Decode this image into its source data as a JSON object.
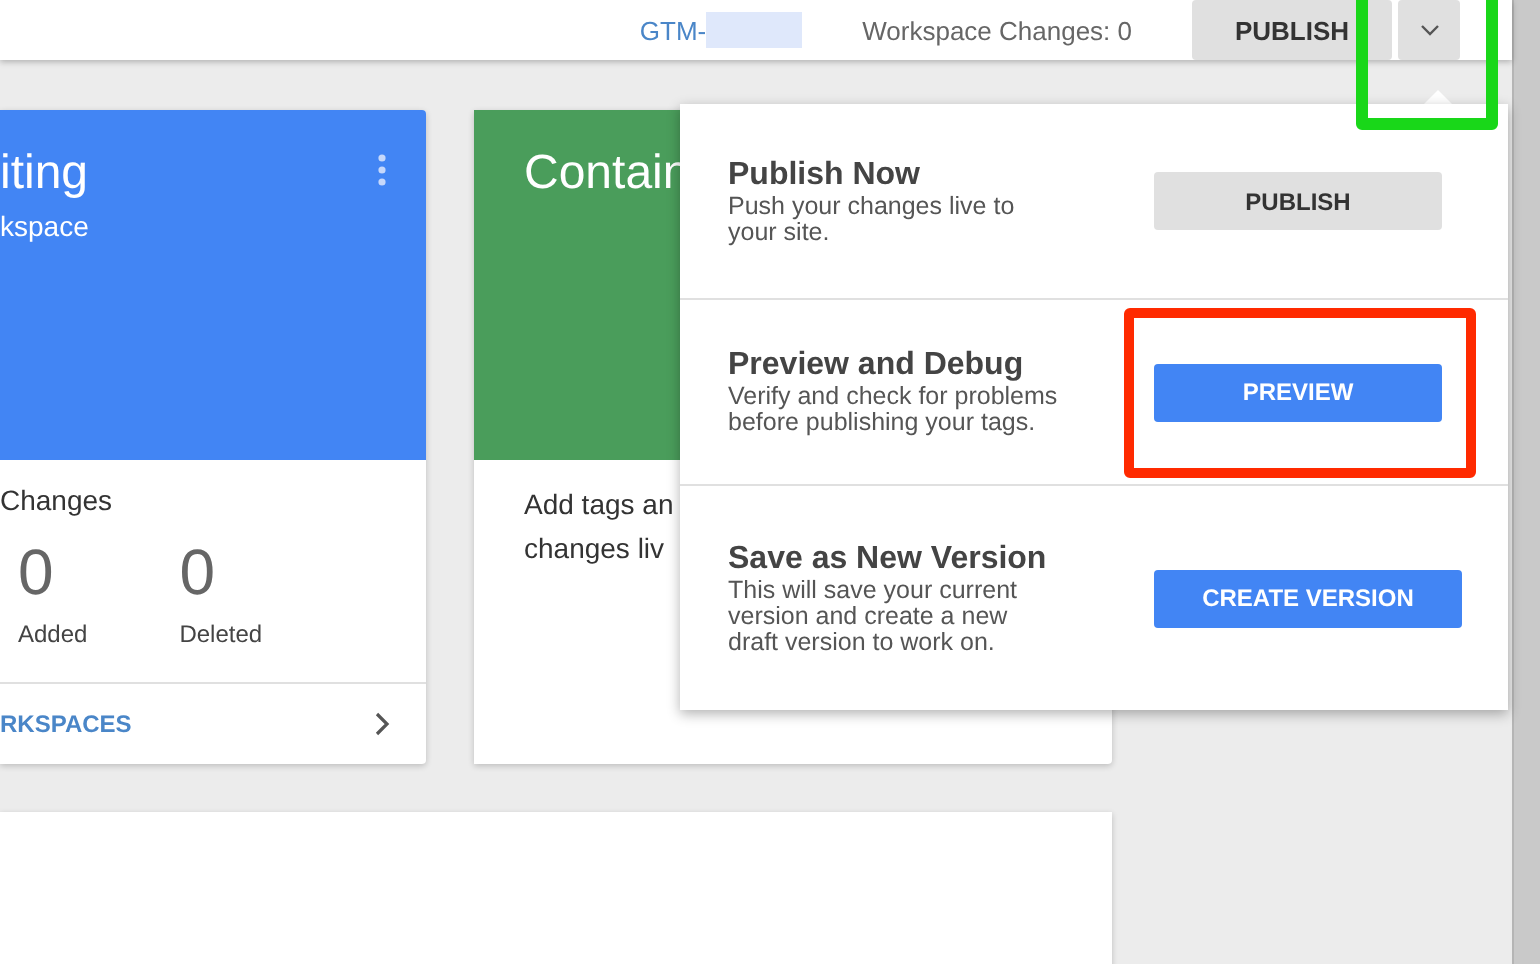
{
  "header": {
    "container_id": "GTM-",
    "workspace_changes": "Workspace Changes: 0",
    "publish_button": "PUBLISH",
    "menu_expanded": true
  },
  "workspace_card": {
    "title": "iting",
    "subtitle": "kspace",
    "changes_heading": "Changes",
    "stats": [
      {
        "value": "0",
        "label": "Added"
      },
      {
        "value": "0",
        "label": "Deleted"
      }
    ],
    "link": "RKSPACES"
  },
  "container_card": {
    "title": "Contain",
    "body_lines": [
      "Add tags an",
      "changes liv"
    ]
  },
  "publish_menu": {
    "options": [
      {
        "title": "Publish Now",
        "description_lines": [
          "Push your changes live to",
          "your site."
        ],
        "button": "PUBLISH",
        "kind": "secondary"
      },
      {
        "title": "Preview and Debug",
        "description_lines": [
          "Verify and check for problems",
          "before publishing your tags."
        ],
        "button": "PREVIEW",
        "kind": "primary"
      },
      {
        "title": "Save as New Version",
        "description_lines": [
          "This will save your current",
          "version and create a new",
          "draft version to work on."
        ],
        "button": "CREATE VERSION",
        "kind": "primary"
      }
    ]
  }
}
